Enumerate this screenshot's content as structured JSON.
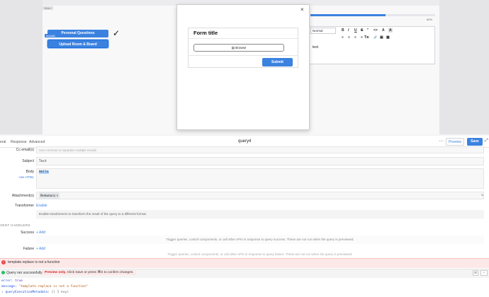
{
  "canvas": {
    "main_label": "Main",
    "modal_tag": "modal1",
    "buttons": {
      "personal_questions": "Personal Questions",
      "upload_room_board": "Upload Room & Board"
    },
    "checkmark": "✓"
  },
  "editor": {
    "progress_text": "60%",
    "progress_value": 0.6,
    "heading_select": "Normal",
    "toolbar_icons": [
      "B",
      "I",
      "U",
      "S",
      "\"",
      "<>",
      "A",
      "A"
    ],
    "toolbar_icons_row2": [
      "≡",
      "≡",
      "≡",
      "≡",
      "≡",
      "🔗",
      "▣",
      "▦",
      "Tx"
    ],
    "content": "test"
  },
  "modal": {
    "close": "×",
    "form_title": "Form title",
    "browse_label": "Browse",
    "submit_label": "Submit"
  },
  "query": {
    "tabs": [
      "eral",
      "Response",
      "Advanced"
    ],
    "name": "query4",
    "menu": "···",
    "preview_label": "Preview",
    "save_label": "Save",
    "expand": "⤢",
    "fields": {
      "cc_label": "Cc email(s)",
      "cc_placeholder": "Use commas to separate multiple emails",
      "subject_label": "Subject",
      "subject_value": "Test",
      "body_label": "Body",
      "body_value": "Hello",
      "use_html": "Use HTML",
      "attachment_label": "Attachment(s)",
      "attachment_chip": "fileButton1",
      "chip_remove": "×",
      "transformer_label": "Transformer",
      "transformer_enable": "Enable",
      "transformer_hint": "Enable transformers to transform the result of the query to a different format."
    },
    "event_handlers": {
      "title": "VENT HANDLERS",
      "success_label": "Success",
      "success_add": "+ Add",
      "success_hint": "Trigger queries, control components, or call other APIs in response to query success. These are not run when the query is previewed.",
      "failure_label": "Failure",
      "failure_add": "+ Add",
      "failure_hint": "Trigger queries, control components, or call other APIs in response to query failure. These are not run when the query is previewed."
    }
  },
  "error": {
    "icon": "!",
    "text": "template.replace is not a function"
  },
  "status": {
    "text": "Query ran successfully",
    "preview_only": "Preview only.",
    "preview_rest": "Click Save or press ⌘S to confirm changes.",
    "clear": "⊘",
    "collapse": "‹"
  },
  "console": {
    "line1_key": "error",
    "line1_val": "true",
    "line2_key": "message",
    "line2_val": "\"template.replace is not a function\"",
    "line3_key": "queryExecutionMetadata",
    "line3_val": "{} 5 keys"
  }
}
